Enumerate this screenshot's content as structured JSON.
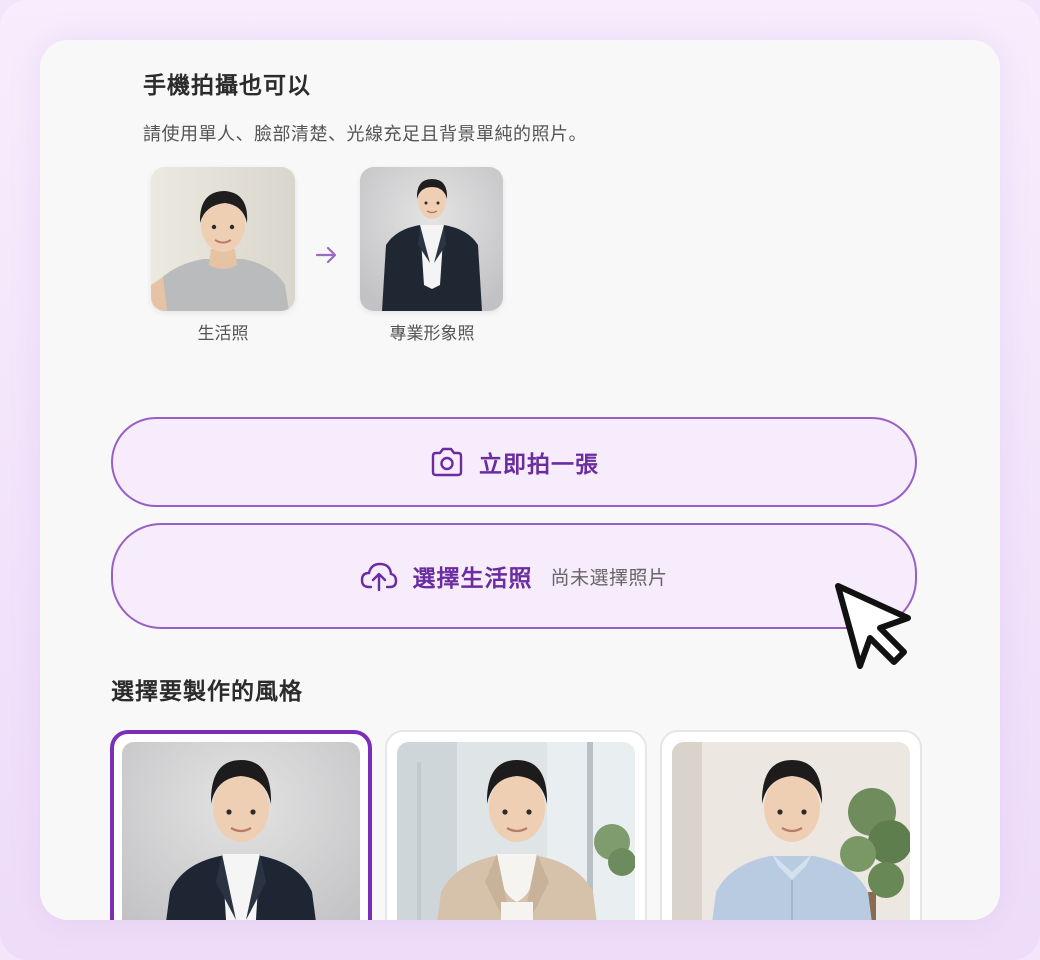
{
  "header": {
    "title": "手機拍攝也可以",
    "subtitle": "請使用單人、臉部清楚、光線充足且背景單純的照片。"
  },
  "example": {
    "before_label": "生活照",
    "after_label": "專業形象照",
    "arrow_icon": "arrow-right-icon"
  },
  "actions": {
    "capture": {
      "icon": "camera-icon",
      "label": "立即拍一張"
    },
    "upload": {
      "icon": "upload-cloud-icon",
      "label": "選擇生活照",
      "status": "尚未選擇照片"
    }
  },
  "styles": {
    "title": "選擇要製作的風格",
    "selected_index": 0
  },
  "colors": {
    "accent": "#7b2fb8",
    "accent_text": "#6a2ca0",
    "button_bg": "#f6ecfb",
    "card_bg": "#f8f8f9"
  }
}
